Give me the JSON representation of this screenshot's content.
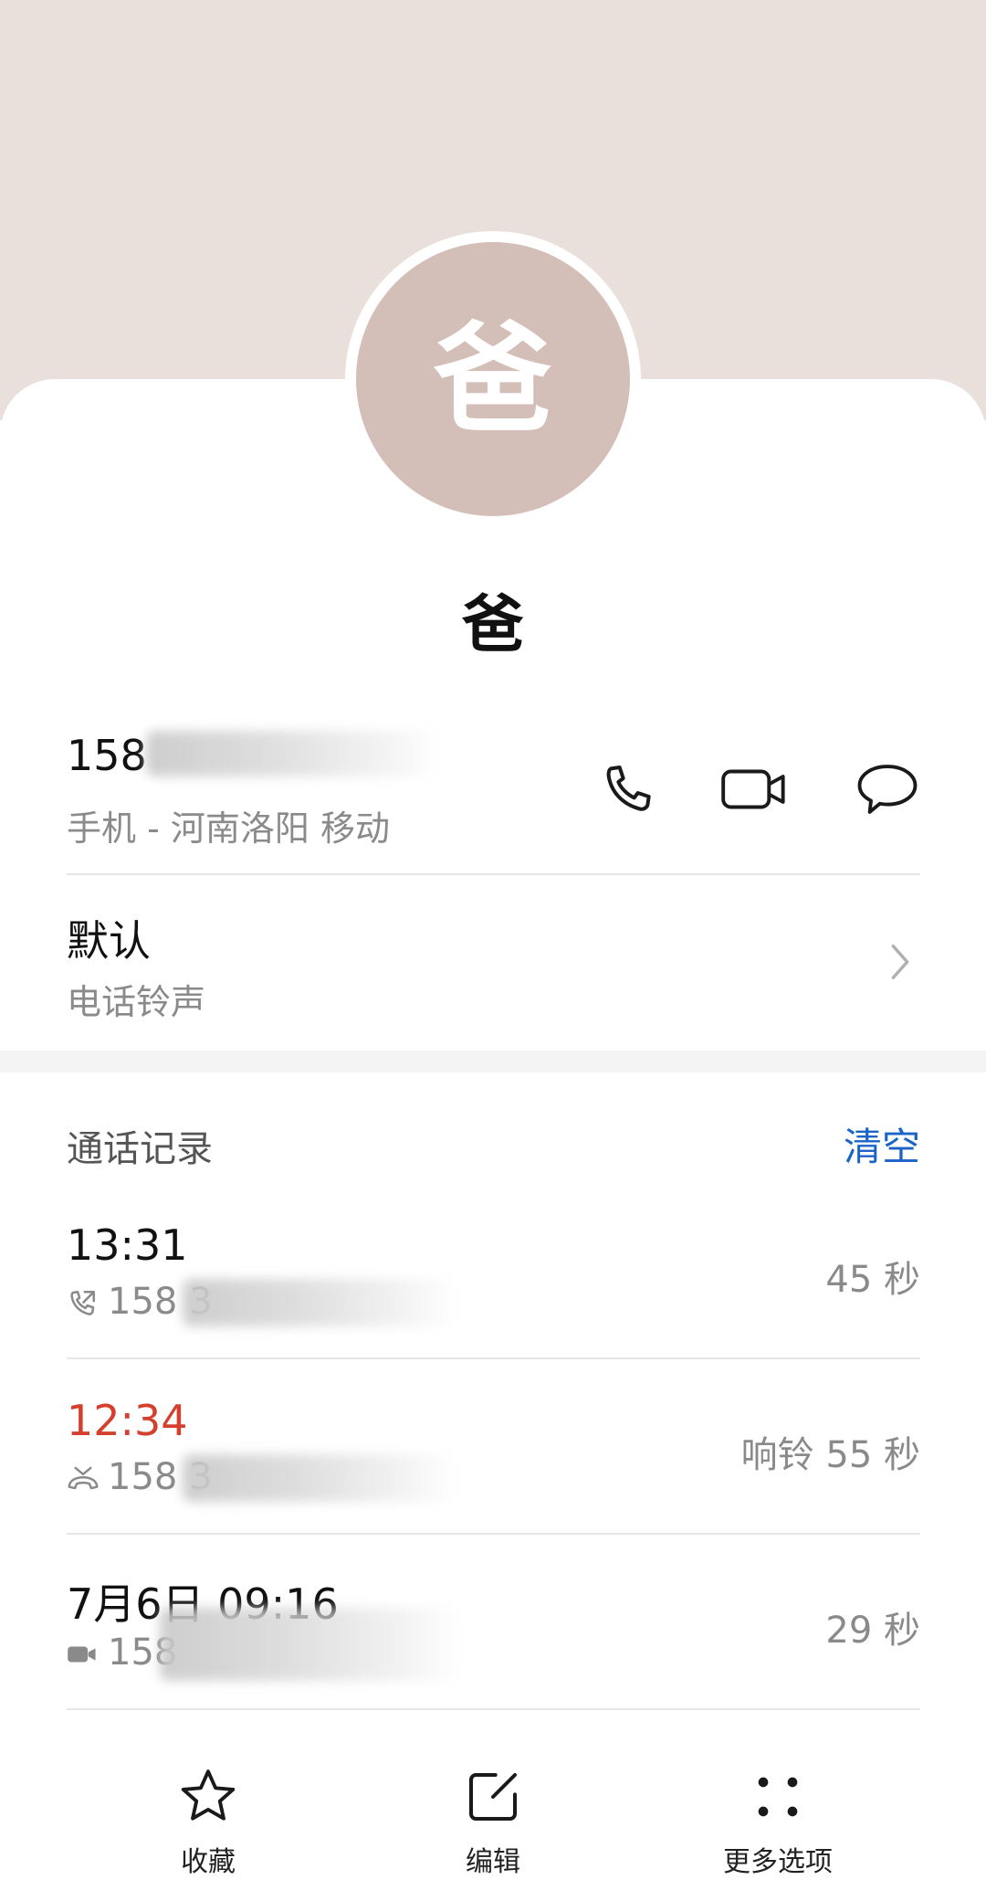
{
  "contact": {
    "avatar_char": "爸",
    "name": "爸"
  },
  "phone": {
    "number_visible": "158",
    "number_partial": "158 ",
    "label": "手机 - 河南洛阳 移动"
  },
  "actions": {
    "call": "phone-icon",
    "video": "video-icon",
    "message": "message-icon"
  },
  "ringtone": {
    "title": "默认",
    "subtitle": "电话铃声"
  },
  "call_log": {
    "title": "通话记录",
    "clear_label": "清空",
    "entries": [
      {
        "time": "13:31",
        "number": "158 3",
        "duration": "45 秒",
        "type": "outgoing",
        "missed": false
      },
      {
        "time": "12:34",
        "number": "158 3",
        "duration": "响铃 55 秒",
        "type": "missed",
        "missed": true
      },
      {
        "time": "7月6日 09:16",
        "number": "158",
        "duration": "29 秒",
        "type": "video",
        "missed": false
      }
    ]
  },
  "bottom_nav": {
    "favorite": "收藏",
    "edit": "编辑",
    "more": "更多选项"
  },
  "colors": {
    "header_bg": "#e9dfdb",
    "avatar_bg": "#d4beb8",
    "accent": "#1b63c6",
    "missed": "#d4402d"
  }
}
